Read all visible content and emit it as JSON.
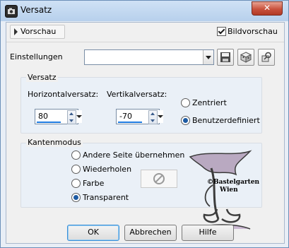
{
  "window": {
    "title": "Versatz",
    "icons": {
      "app": "camera-icon",
      "close": "close-icon"
    }
  },
  "preview": {
    "vorschau_label": "Vorschau",
    "bildvorschau_label": "Bildvorschau",
    "bildvorschau_checked": true
  },
  "settings": {
    "label": "Einstellungen",
    "combo_value": "",
    "tool_icons": [
      "save-icon",
      "cube-icon",
      "preset-icon"
    ]
  },
  "versatz_group": {
    "legend": "Versatz",
    "horizontal_label": "Horizontalversatz:",
    "horizontal_value": "80",
    "vertical_label": "Vertikalversatz:",
    "vertical_value": "-70",
    "radio_zentriert": "Zentriert",
    "radio_benutzerdefiniert": "Benutzerdefiniert",
    "selected": "Benutzerdefiniert"
  },
  "kantenmodus_group": {
    "legend": "Kantenmodus",
    "options": [
      "Andere Seite übernehmen",
      "Wiederholen",
      "Farbe",
      "Transparent"
    ],
    "selected": "Transparent"
  },
  "watermark": {
    "text_line1": "©Bastelgarten",
    "text_line2": "Wien"
  },
  "buttons": {
    "ok": "OK",
    "cancel": "Abbrechen",
    "help": "Hilfe"
  },
  "colors": {
    "accent": "#1e7ae0",
    "titlebar": "#c4dcf4",
    "close": "#c9523d"
  }
}
